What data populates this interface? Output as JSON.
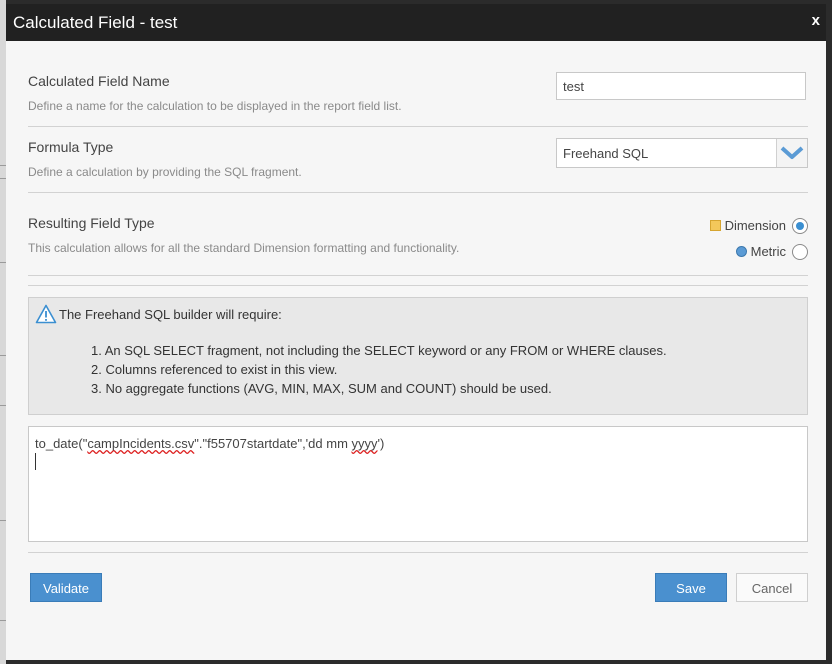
{
  "dialog": {
    "title": "Calculated Field - test",
    "close_label": "x"
  },
  "name_section": {
    "label": "Calculated Field Name",
    "description": "Define a name for the calculation to be displayed in the report field list.",
    "value": "test"
  },
  "formula_section": {
    "label": "Formula Type",
    "description": "Define a calculation by providing the SQL fragment.",
    "selected": "Freehand SQL"
  },
  "result_section": {
    "label": "Resulting Field Type",
    "description": "This calculation allows for all the standard Dimension formatting and functionality.",
    "options": [
      {
        "label": "Dimension",
        "checked": true,
        "swatch_color": "#f3c85b"
      },
      {
        "label": "Metric",
        "checked": false,
        "swatch_color": "#5b9bd5"
      }
    ]
  },
  "info": {
    "icon": "warning-icon",
    "title": "The Freehand SQL builder will require:",
    "items": [
      "1. An SQL SELECT fragment, not including the SELECT keyword or any FROM or WHERE clauses.",
      "2. Columns referenced to exist in this view.",
      "3. No aggregate functions (AVG, MIN, MAX, SUM and COUNT) should be used."
    ]
  },
  "editor": {
    "code": {
      "p1": "to_date(\"",
      "p2": "campIncidents.csv",
      "p3": "\".\"f55707startdate\",'dd mm ",
      "p4": "yyyy",
      "p5": "')"
    }
  },
  "buttons": {
    "validate": "Validate",
    "save": "Save",
    "cancel": "Cancel"
  },
  "colors": {
    "accent": "#4a90cf",
    "titlebar": "#212121"
  }
}
